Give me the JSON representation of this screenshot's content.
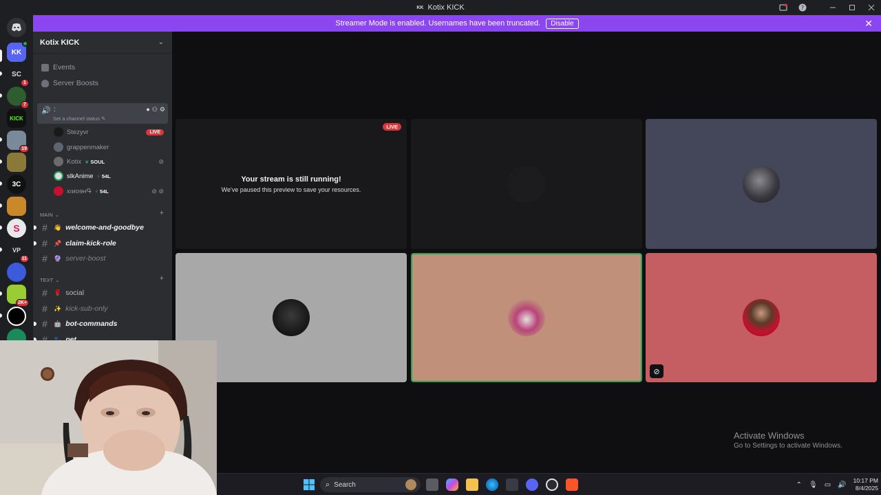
{
  "titlebar": {
    "app_badge": "KK",
    "title": "Kotix KICK"
  },
  "banner": {
    "message": "Streamer Mode is enabled. Usernames have been truncated.",
    "disable_label": "Disable",
    "color": "#8c46f0"
  },
  "rail": {
    "servers": [
      {
        "label": "KK",
        "badge": ""
      },
      {
        "label": "SC",
        "badge": "1"
      },
      {
        "label": "",
        "badge": "7"
      },
      {
        "label": "KICK",
        "badge": ""
      },
      {
        "label": "",
        "badge": "19"
      },
      {
        "label": "",
        "badge": ""
      },
      {
        "label": "3C",
        "badge": ""
      },
      {
        "label": "",
        "badge": ""
      },
      {
        "label": "S",
        "badge": ""
      },
      {
        "label": "VP",
        "badge": "11"
      },
      {
        "label": "",
        "badge": ""
      },
      {
        "label": "",
        "badge": "2K+"
      },
      {
        "label": "",
        "badge": ""
      },
      {
        "label": "",
        "badge": ""
      }
    ]
  },
  "sidebar": {
    "guild_name": "Kotix KICK",
    "events_label": "Events",
    "boosts_label": "Server Boosts",
    "voice_channel": {
      "name": ":",
      "status": "Set a channel status"
    },
    "members": [
      {
        "name": "Stezyvr",
        "tag": "",
        "live": "LIVE"
      },
      {
        "name": "grappenmaker",
        "tag": "",
        "live": ""
      },
      {
        "name": "Kotix",
        "tag": "SOUL",
        "live": ""
      },
      {
        "name": "slkAnime",
        "tag": "54L",
        "live": ""
      },
      {
        "name": "хıиoɘʜԳ",
        "tag": "54L",
        "live": ""
      }
    ],
    "categories": {
      "main": "MAIN",
      "text": "TEXT"
    },
    "main_channels": [
      {
        "emoji": "👋",
        "name": "welcome-and-goodbye"
      },
      {
        "emoji": "📌",
        "name": "claim-kick-role"
      },
      {
        "emoji": "🔮",
        "name": "server-boost"
      }
    ],
    "text_channels": [
      {
        "emoji": "🌹",
        "name": "social"
      },
      {
        "emoji": "✨",
        "name": "kick-sub-only"
      },
      {
        "emoji": "🤖",
        "name": "bot-commands"
      },
      {
        "emoji": "🐾",
        "name": "pet"
      }
    ]
  },
  "stage": {
    "live_label": "LIVE",
    "paused_title": "Your stream is still running!",
    "paused_sub": "We've paused this preview to save your resources."
  },
  "windows_watermark": {
    "line1": "Activate Windows",
    "line2": "Go to Settings to activate Windows."
  },
  "taskbar": {
    "search_placeholder": "Search",
    "time": "10:17 PM",
    "date": "8/4/2025"
  }
}
